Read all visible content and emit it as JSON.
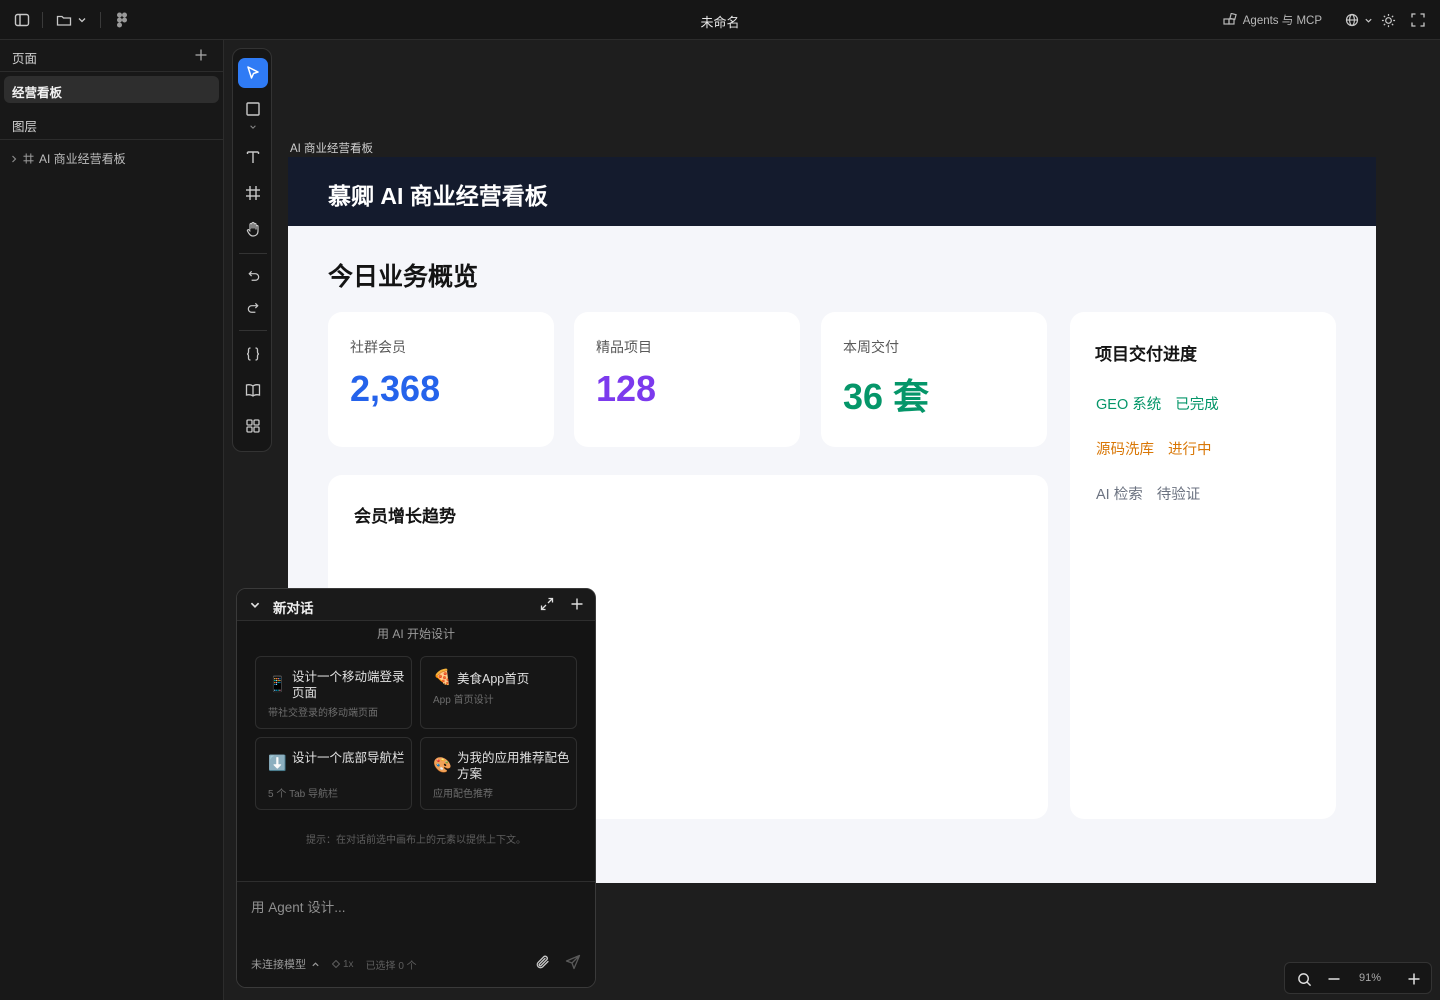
{
  "app": {
    "document_title": "未命名"
  },
  "topbar": {
    "agents_label": "Agents 与 MCP"
  },
  "sidebar": {
    "pages_heading": "页面",
    "pages": [
      {
        "label": "经营看板",
        "selected": true
      }
    ],
    "layers_heading": "图层",
    "layers": [
      {
        "label": "AI 商业经营看板"
      }
    ]
  },
  "toolbar": {
    "tools": [
      "select-tool",
      "rectangle-tool",
      "text-tool",
      "frame-tool",
      "hand-tool",
      "undo",
      "redo",
      "code-tool",
      "library-tool",
      "components-tool"
    ],
    "active_tool": "select-tool",
    "accent_color": "#2f7bf5"
  },
  "canvas": {
    "frame_label": "AI 商业经营看板",
    "header_title": "慕卿 AI 商业经营看板",
    "section_title": "今日业务概览",
    "stats": [
      {
        "label": "社群会员",
        "value": "2,368",
        "color": "#2563eb"
      },
      {
        "label": "精品项目",
        "value": "128",
        "color": "#7c3aed"
      },
      {
        "label": "本周交付",
        "value": "36 套",
        "color": "#059669"
      }
    ],
    "growth_title": "会员增长趋势",
    "progress_title": "项目交付进度",
    "progress": [
      {
        "name": "GEO 系统",
        "status": "已完成",
        "color": "#059669"
      },
      {
        "name": "源码洗库",
        "status": "进行中",
        "color": "#d97706"
      },
      {
        "name": "AI 检索",
        "status": "待验证",
        "color": "#6b7280"
      }
    ]
  },
  "chat": {
    "title": "新对话",
    "subtitle": "用 AI 开始设计",
    "suggestions": [
      {
        "icon": "📱",
        "title": "设计一个移动端登录页面",
        "desc": "带社交登录的移动端页面"
      },
      {
        "icon": "🍕",
        "title": "美食App首页",
        "desc": "App 首页设计"
      },
      {
        "icon": "⬇️",
        "title": "设计一个底部导航栏",
        "desc": "5 个 Tab 导航栏"
      },
      {
        "icon": "🎨",
        "title": "为我的应用推荐配色方案",
        "desc": "应用配色推荐"
      }
    ],
    "hint": "提示：在对话前选中画布上的元素以提供上下文。",
    "input_placeholder": "用 Agent 设计...",
    "model_label": "未连接模型",
    "multiplier_label": "1x",
    "selection_label": "已选择 0 个"
  },
  "zoom": {
    "level": "91%"
  }
}
